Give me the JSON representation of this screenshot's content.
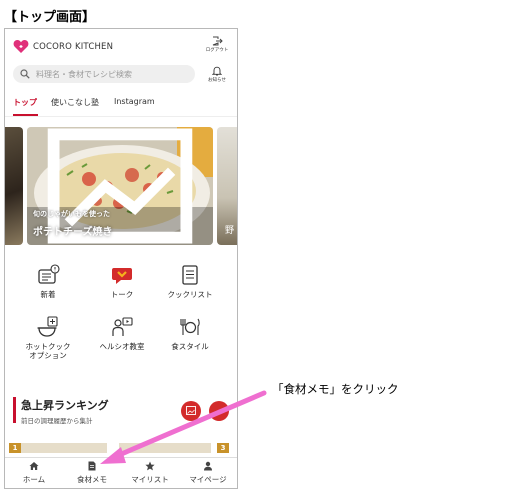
{
  "page_heading": "【トップ画面】",
  "header": {
    "logo_text": "COCORO KITCHEN",
    "logout_label": "ログアウト",
    "notify_label": "お知らせ",
    "search_placeholder": "料理名・食材でレシピ検索"
  },
  "tabs": [
    {
      "label": "トップ",
      "active": true
    },
    {
      "label": "使いこなし塾",
      "active": false
    },
    {
      "label": "Instagram",
      "active": false
    }
  ],
  "carousel": {
    "subtitle": "旬のじゃがいもを使った",
    "title": "ポテトチーズ焼き",
    "peek_text": "野"
  },
  "menu": [
    {
      "label": "新着",
      "icon": "news-icon"
    },
    {
      "label": "トーク",
      "icon": "talk-icon"
    },
    {
      "label": "クックリスト",
      "icon": "cooklist-icon"
    },
    {
      "label": "ホットクック",
      "label2": "オプション",
      "icon": "hotcook-icon"
    },
    {
      "label": "ヘルシオ教室",
      "icon": "healsio-class-icon"
    },
    {
      "label": "食スタイル",
      "icon": "food-style-icon"
    }
  ],
  "ranking": {
    "title": "急上昇ランキング",
    "subtitle": "前日の調理履歴から集計",
    "first_rank": "1",
    "third_rank": "3"
  },
  "bottom_nav": [
    {
      "label": "ホーム",
      "icon": "home-icon"
    },
    {
      "label": "食材メモ",
      "icon": "memo-icon"
    },
    {
      "label": "マイリスト",
      "icon": "star-icon"
    },
    {
      "label": "マイページ",
      "icon": "person-icon"
    }
  ],
  "annotation": {
    "text": "「食材メモ」をクリック",
    "arrow_color": "#ef6fd0"
  },
  "colors": {
    "brand_red": "#c8102e",
    "heart_pink": "#e0307a"
  }
}
